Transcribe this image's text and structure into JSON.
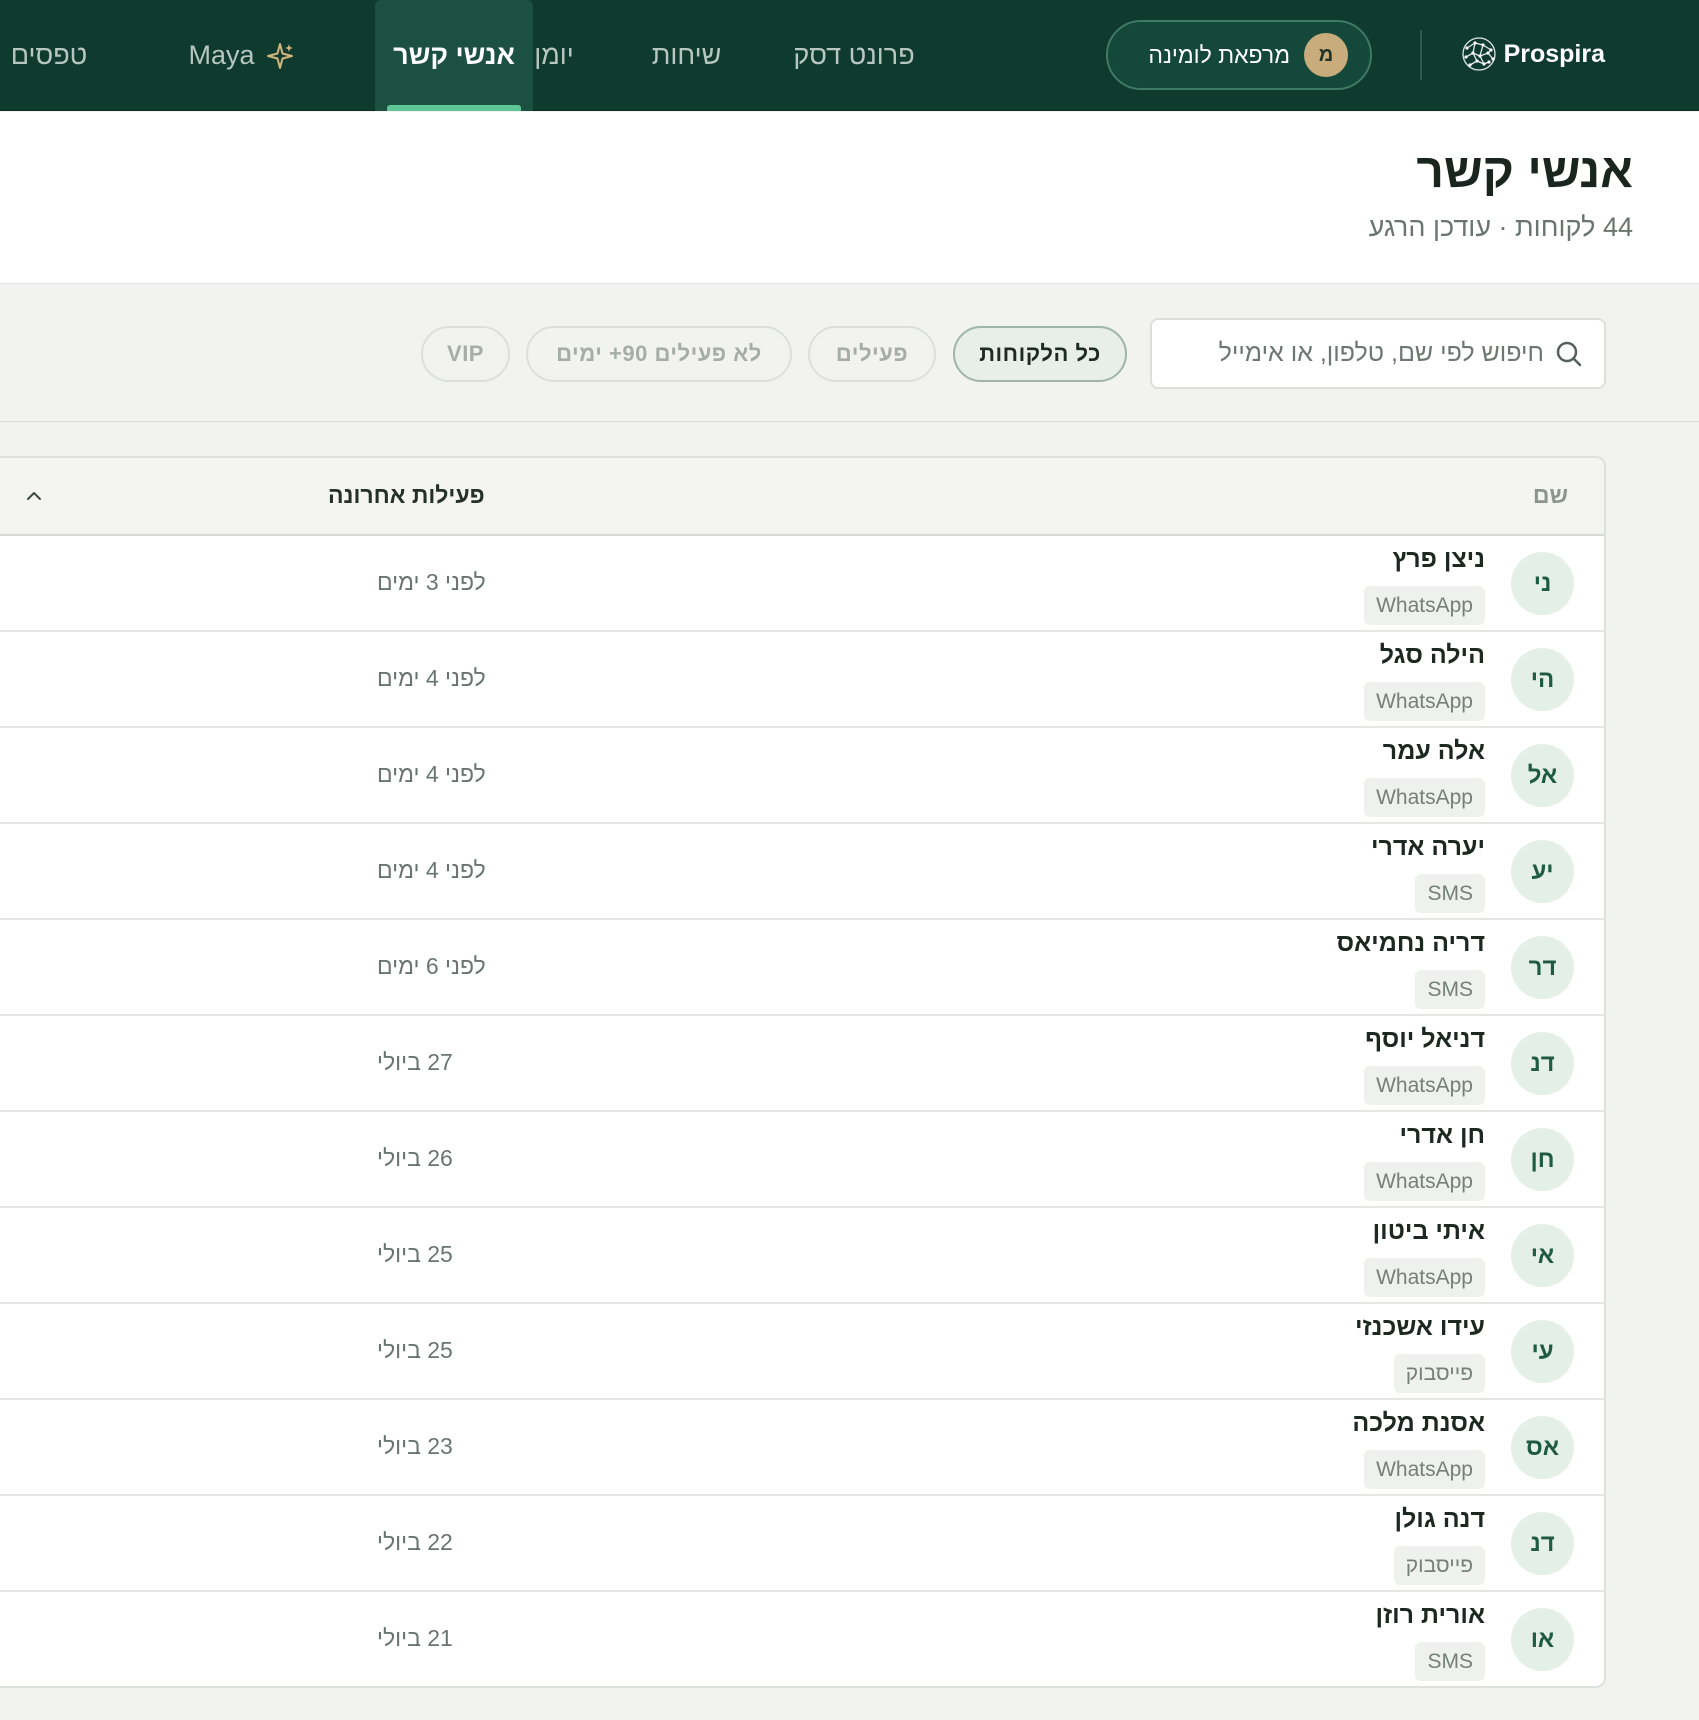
{
  "brand": {
    "name": "Prospira"
  },
  "clinic": {
    "initial": "מ",
    "name": "מרפאת לומינה"
  },
  "nav": {
    "front_desk": "פרונט דסק",
    "conversations": "שיחות",
    "calendar": "יומן",
    "contacts": "אנשי קשר",
    "maya": "Maya",
    "forms": "טפסים"
  },
  "header": {
    "title": "אנשי קשר",
    "subtitle": "44 לקוחות · עודכן הרגע"
  },
  "search": {
    "placeholder": "חיפוש לפי שם, טלפון, או אימייל"
  },
  "filters": {
    "all": "כל הלקוחות",
    "active": "פעילים",
    "inactive": "לא פעילים 90+ ימים",
    "vip": "VIP"
  },
  "table": {
    "columns": {
      "name": "שם",
      "last_activity": "פעילות אחרונה"
    },
    "rows": [
      {
        "initials": "ני",
        "name": "ניצן פרץ",
        "channel": "WhatsApp",
        "activity": "לפני 3 ימים"
      },
      {
        "initials": "הי",
        "name": "הילה סגל",
        "channel": "WhatsApp",
        "activity": "לפני 4 ימים"
      },
      {
        "initials": "אל",
        "name": "אלה עמר",
        "channel": "WhatsApp",
        "activity": "לפני 4 ימים"
      },
      {
        "initials": "יע",
        "name": "יערה אדרי",
        "channel": "SMS",
        "activity": "לפני 4 ימים"
      },
      {
        "initials": "דר",
        "name": "דריה נחמיאס",
        "channel": "SMS",
        "activity": "לפני 6 ימים"
      },
      {
        "initials": "דנ",
        "name": "דניאל יוסף",
        "channel": "WhatsApp",
        "activity": "27 ביולי"
      },
      {
        "initials": "חן",
        "name": "חן אדרי",
        "channel": "WhatsApp",
        "activity": "26 ביולי"
      },
      {
        "initials": "אי",
        "name": "איתי ביטון",
        "channel": "WhatsApp",
        "activity": "25 ביולי"
      },
      {
        "initials": "עי",
        "name": "עידו אשכנזי",
        "channel": "פייסבוק",
        "activity": "25 ביולי"
      },
      {
        "initials": "אס",
        "name": "אסנת מלכה",
        "channel": "WhatsApp",
        "activity": "23 ביולי"
      },
      {
        "initials": "דנ",
        "name": "דנה גולן",
        "channel": "פייסבוק",
        "activity": "22 ביולי"
      },
      {
        "initials": "או",
        "name": "אורית רוזן",
        "channel": "SMS",
        "activity": "21 ביולי"
      }
    ]
  },
  "colors": {
    "nav_bg": "#0f3a2e",
    "accent": "#5ec795",
    "avatar_bg": "#e4efe8",
    "clinic_avatar": "#c9ac7c"
  },
  "icons": {
    "brand": "brain-network-icon",
    "maya": "sparkle-icon",
    "search": "search-icon",
    "sort": "chevron-up-icon"
  }
}
